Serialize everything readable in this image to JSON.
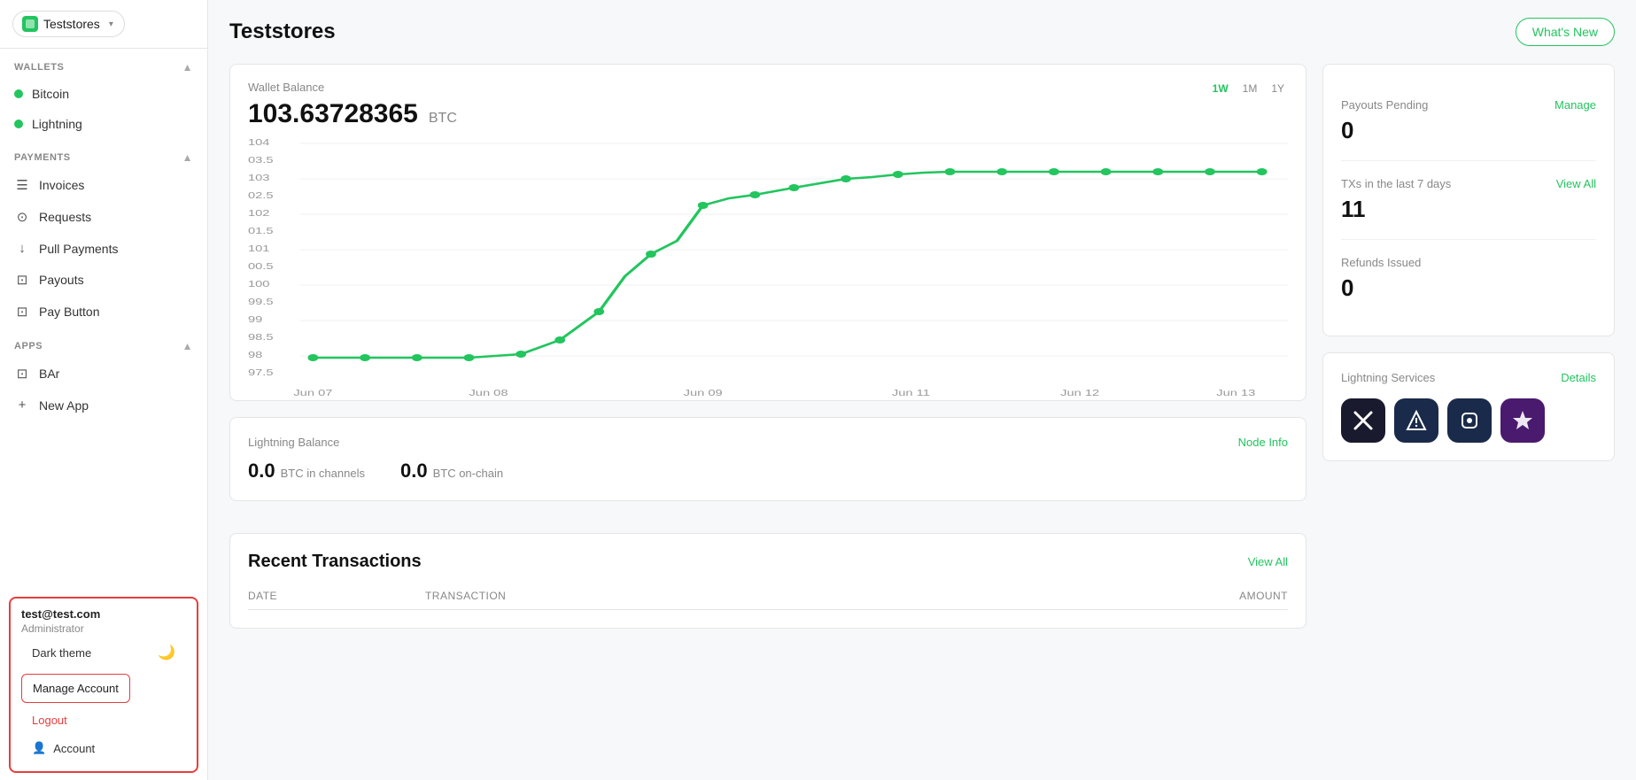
{
  "app": {
    "title": "Teststores",
    "whats_new": "What's New"
  },
  "sidebar": {
    "store_name": "Teststores",
    "wallets_section": "WALLETS",
    "bitcoin_label": "Bitcoin",
    "lightning_label": "Lightning",
    "payments_section": "PAYMENTS",
    "invoices_label": "Invoices",
    "requests_label": "Requests",
    "pull_payments_label": "Pull Payments",
    "payouts_label": "Payouts",
    "pay_button_label": "Pay Button",
    "apps_section": "APPS",
    "bar_label": "BAr",
    "new_app_label": "New App",
    "account_email": "test@test.com",
    "account_role": "Administrator",
    "dark_theme_label": "Dark theme",
    "manage_account_label": "Manage Account",
    "logout_label": "Logout",
    "account_label": "Account"
  },
  "wallet": {
    "label": "Wallet Balance",
    "amount": "103.63728365",
    "unit": "BTC",
    "time_filters": [
      "1W",
      "1M",
      "1Y"
    ],
    "active_filter": "1W",
    "chart": {
      "y_labels": [
        "104",
        "03.5",
        "103",
        "02.5",
        "102",
        "01.5",
        "101",
        "00.5",
        "100",
        "99.5",
        "99",
        "98.5",
        "98",
        "97.5"
      ],
      "x_labels": [
        "Jun 07",
        "Jun 08",
        "Jun 09",
        "Jun 11",
        "Jun 12",
        "Jun 13"
      ]
    }
  },
  "stats": {
    "payouts_pending_label": "Payouts Pending",
    "payouts_pending_value": "0",
    "payouts_manage_label": "Manage",
    "txs_label": "TXs in the last 7 days",
    "txs_value": "11",
    "txs_view_all": "View All",
    "refunds_label": "Refunds Issued",
    "refunds_value": "0"
  },
  "lightning": {
    "label": "Lightning Balance",
    "node_info_label": "Node Info",
    "in_channels_value": "0.0",
    "in_channels_unit": "BTC in channels",
    "on_chain_value": "0.0",
    "on_chain_unit": "BTC on-chain"
  },
  "services": {
    "label": "Lightning Services",
    "details_label": "Details",
    "icons": [
      "✕",
      "⚡",
      "⚙",
      "⚡"
    ]
  },
  "transactions": {
    "title": "Recent Transactions",
    "view_all_label": "View All",
    "columns": [
      "Date",
      "Transaction",
      "Amount"
    ]
  }
}
